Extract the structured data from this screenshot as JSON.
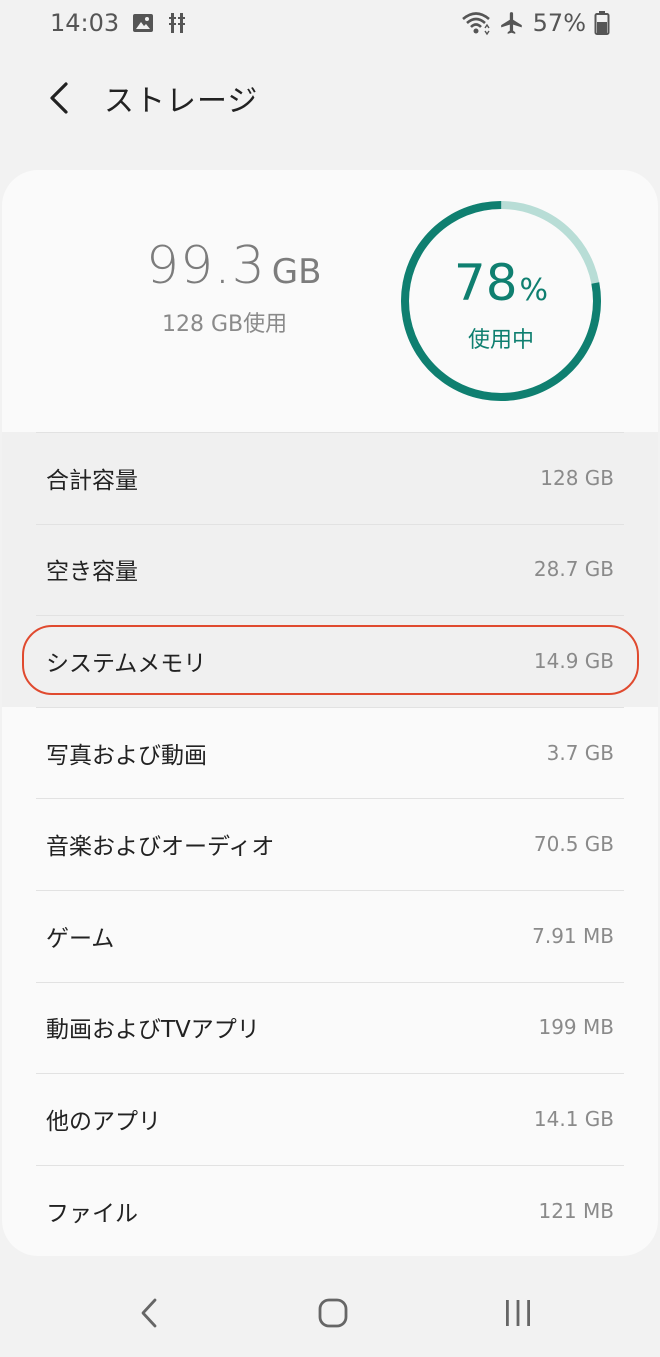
{
  "status_bar": {
    "time": "14:03",
    "battery": "57%",
    "icons": [
      "image-icon",
      "usb-debug-icon",
      "wifi-icon",
      "airplane-icon",
      "battery-icon"
    ]
  },
  "app_bar": {
    "title": "ストレージ"
  },
  "summary": {
    "used_value": "99.3",
    "used_unit": "GB",
    "capacity_text": "128 GB使用",
    "percent": "78",
    "percent_sign": "%",
    "percent_fraction": 0.78,
    "ring_label": "使用中",
    "accent_color": "#0f7f70",
    "track_color": "#b8ddd6"
  },
  "storage_items": [
    {
      "label": "合計容量",
      "value": "128 GB"
    },
    {
      "label": "空き容量",
      "value": "28.7 GB"
    },
    {
      "label": "システムメモリ",
      "value": "14.9 GB"
    },
    {
      "label": "写真および動画",
      "value": "3.7 GB"
    },
    {
      "label": "音楽およびオーディオ",
      "value": "70.5 GB"
    },
    {
      "label": "ゲーム",
      "value": "7.91 MB"
    },
    {
      "label": "動画およびTVアプリ",
      "value": "199 MB"
    },
    {
      "label": "他のアプリ",
      "value": "14.1 GB"
    },
    {
      "label": "ファイル",
      "value": "121 MB"
    }
  ],
  "highlight_color": "#e04a2f"
}
